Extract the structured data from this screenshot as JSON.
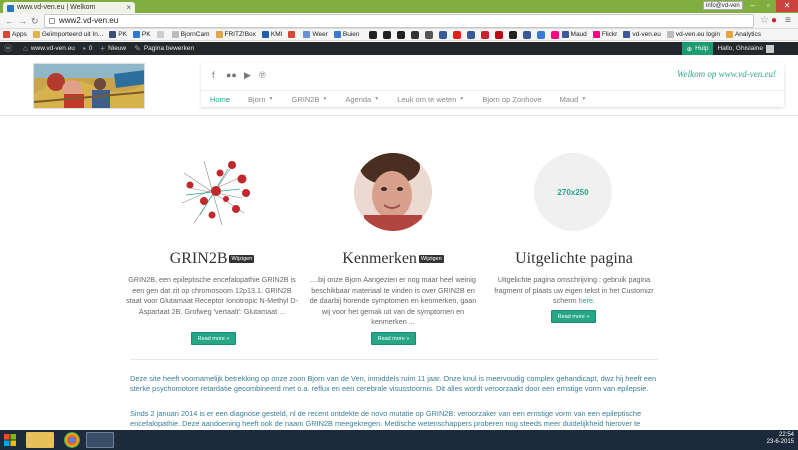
{
  "browser": {
    "tab_title": "www.vd-ven.eu | Welkom",
    "profile_label": "info@vd-ven",
    "address": "www2.vd-ven.eu"
  },
  "bookmarks": [
    {
      "label": "Apps",
      "color": "#d34836"
    },
    {
      "label": "Geïmporteerd uit In...",
      "color": "#e3b34a"
    },
    {
      "label": "PK",
      "color": "#3c4f7a"
    },
    {
      "label": "PK",
      "color": "#2b7bd3"
    },
    {
      "label": "",
      "color": "#cccccc"
    },
    {
      "label": "BjornCam",
      "color": "#bdbdbd"
    },
    {
      "label": "FRITZ!Box",
      "color": "#e3a54a"
    },
    {
      "label": "KMI",
      "color": "#1f5fae"
    },
    {
      "label": "",
      "color": "#d34836"
    },
    {
      "label": "Weer",
      "color": "#6a8fd8"
    },
    {
      "label": "Buien",
      "color": "#3a7ad0"
    }
  ],
  "bookmarks_right": [
    {
      "label": "Maud",
      "color": "#3b5998"
    },
    {
      "label": "Flickr",
      "color": "#ff0084"
    },
    {
      "label": "vd-ven.eu",
      "color": "#3b5998"
    },
    {
      "label": "vd-ven.eu login",
      "color": "#bdbdbd"
    },
    {
      "label": "Analytics",
      "color": "#e8a33c"
    }
  ],
  "adminbar": {
    "site": "www.vd-ven.eu",
    "comments": "0",
    "new": "Nieuw",
    "edit": "Pagina bewerken",
    "help": "Hulp",
    "greeting": "Hallo, Ghislaine"
  },
  "header": {
    "welcome": "Welkom op www.vd-ven.eu!",
    "social_icons": [
      "facebook-icon",
      "flickr-icon",
      "youtube-icon",
      "pinterest-icon"
    ]
  },
  "menu": [
    {
      "label": "Home",
      "active": true,
      "dropdown": false
    },
    {
      "label": "Bjorn",
      "active": false,
      "dropdown": true
    },
    {
      "label": "GRIN2B",
      "active": false,
      "dropdown": true
    },
    {
      "label": "Agenda",
      "active": false,
      "dropdown": true
    },
    {
      "label": "Leuk om te weten",
      "active": false,
      "dropdown": true
    },
    {
      "label": "Bjorn op Zonhove",
      "active": false,
      "dropdown": false
    },
    {
      "label": "Maud",
      "active": false,
      "dropdown": true
    }
  ],
  "features": [
    {
      "title": "GRIN2B",
      "edit": "Wijzigen",
      "text": "GRIN2B, een epileptische encefalopathie GRIN2B is een gen dat zit op chromosoom 12p13.1. GRIN2B staat voor Glutamaat Receptor Ionotropic N-Methyl D-Aspartaat 2B. Grofweg 'vertaalt': Glutamaat ...",
      "button": "Read more »"
    },
    {
      "title": "Kenmerken",
      "edit": "Wijzigen",
      "text": "....bij onze Bjorn Aangezien er nog maar heel weinig beschikbaar materiaal te vinden is over GRIN2B en de daarbij horende symptomen en kenmerken, gaan wij voor het gemak uit van de symptomen en kenmerken ...",
      "button": "Read more »"
    },
    {
      "title": "Uitgelichte pagina",
      "placeholder": "270x250",
      "text_before": "Uitgelichte pagina omschrijving : gebruik pagina fragment of plaats uw eigen tekst in het Customizr scherm ",
      "link": "here",
      "text_after": ".",
      "button": "Read more »"
    }
  ],
  "paragraphs": [
    "Deze site heeft voornamelijk betrekking op onze zoon Bjorn van de Ven, inmiddels ruim 11 jaar. Onze knul is meervoudig complex gehandicapt, dwz hij heeft een sterke psychomotore retardatie gecombineerd met o.a. reflux en een cerebrale visusstoornis. Dit alles wordt veroorzaakt door een ernstige vorm van epilepsie.",
    "Sinds 2 januari 2014 is er een diagnose gesteld, nl de recent ontdekte de novo mutatie op GRIN2B: veroorzaker van een ernstige vorm van een epileptische encefalopathie.  Deze aandoening heeft ook de naam GRIN2B meegekregen. Medische wetenschappers proberen nog steeds meer duidelijkheid hierover te"
  ],
  "taskbar": {
    "time": "22:54",
    "date": "23-6-2015"
  },
  "colors": {
    "accent": "#27a687",
    "chrome_green": "#7fae3e",
    "admin_bar": "#23282d",
    "taskbar": "#1c2a3c"
  }
}
